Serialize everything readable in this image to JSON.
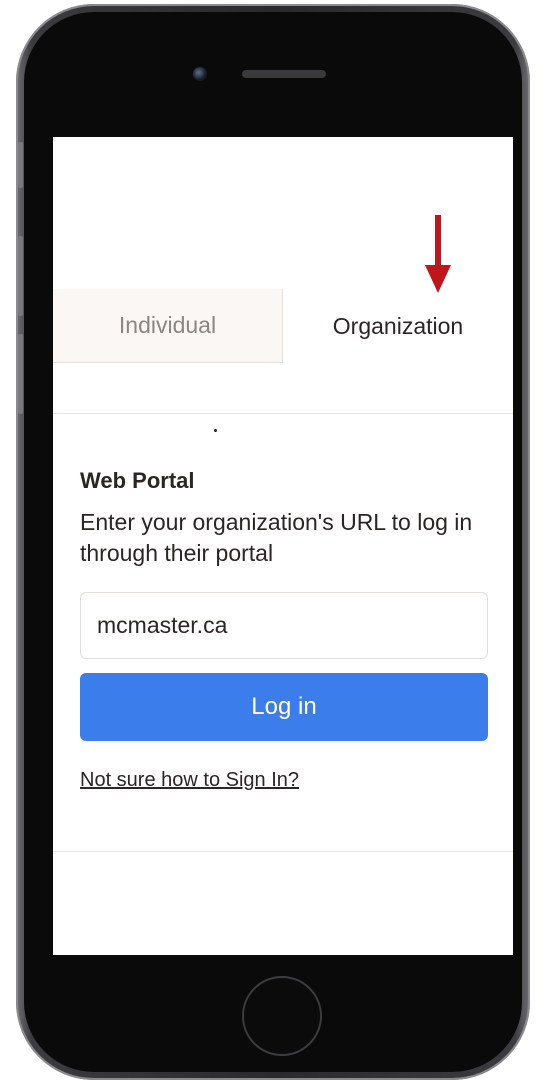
{
  "tabs": {
    "individual_label": "Individual",
    "organization_label": "Organization"
  },
  "portal": {
    "title": "Web Portal",
    "description": "Enter your organization's URL to log in through their portal",
    "url_value": "mcmaster.ca",
    "login_label": "Log in",
    "help_link": "Not sure how to Sign In?"
  },
  "colors": {
    "primary_button": "#3b7deb",
    "annotation_arrow": "#c0151b"
  },
  "icons": {
    "annotation": "down-arrow-icon"
  }
}
